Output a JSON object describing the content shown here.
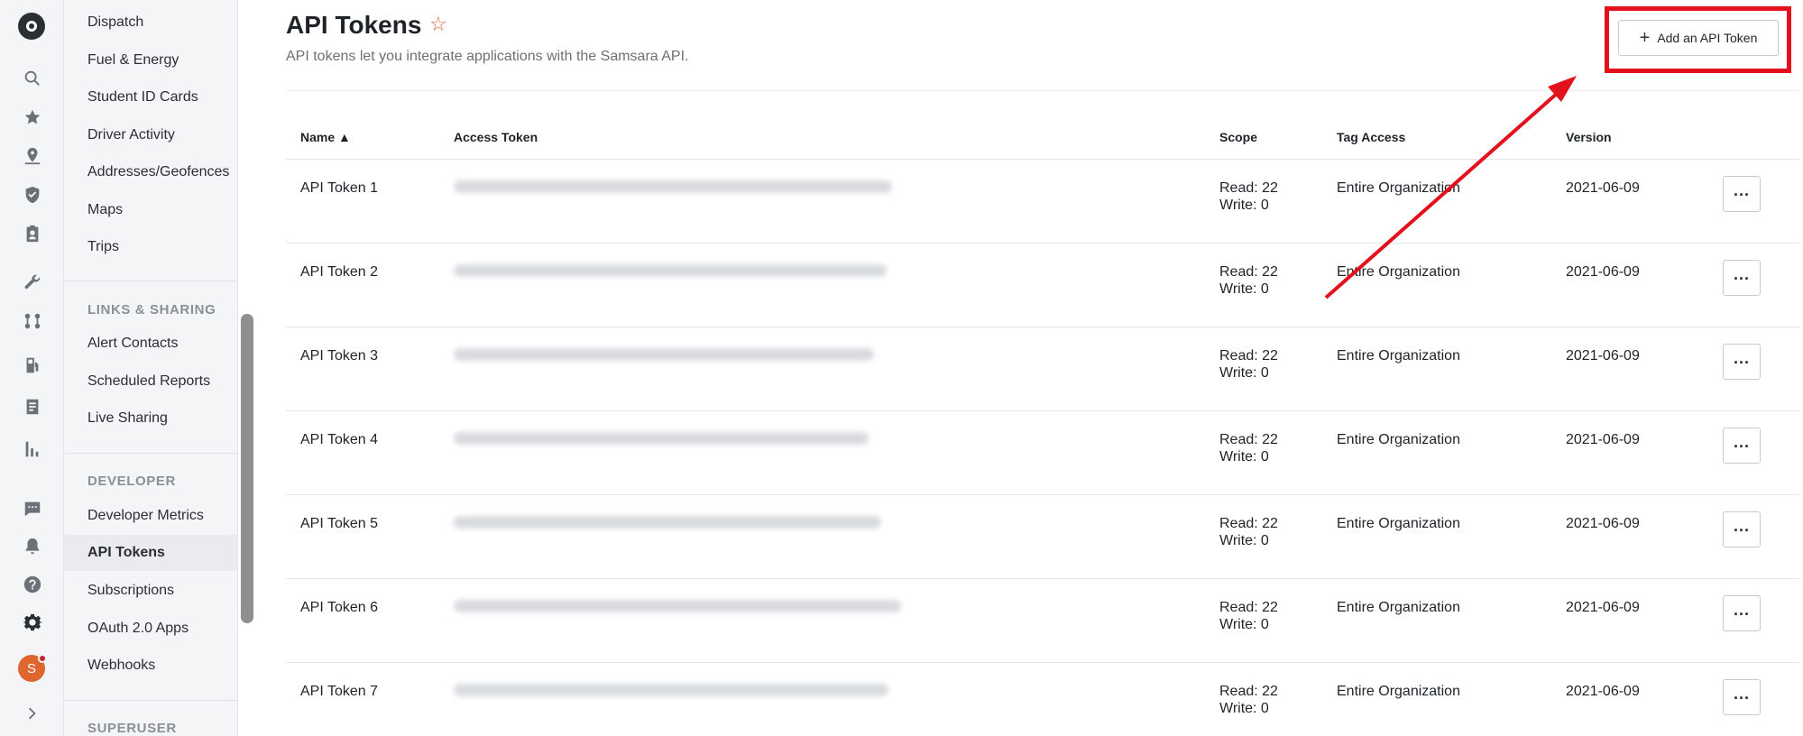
{
  "rail": {
    "icons": [
      "logo-icon",
      "search-icon",
      "star-icon",
      "map-pin-icon",
      "shield-icon",
      "clipboard-icon",
      "wrench-icon",
      "route-icon",
      "fuel-icon",
      "document-icon",
      "bar-chart-icon",
      "chat-icon",
      "bell-icon",
      "help-icon",
      "gear-icon",
      "chevron-right-icon"
    ],
    "avatar_initial": "S"
  },
  "nav": {
    "items_top": [
      "Dispatch",
      "Fuel & Energy",
      "Student ID Cards",
      "Driver Activity",
      "Addresses/Geofences",
      "Maps",
      "Trips"
    ],
    "section_links": "LINKS & SHARING",
    "items_links": [
      "Alert Contacts",
      "Scheduled Reports",
      "Live Sharing"
    ],
    "section_developer": "DEVELOPER",
    "items_developer": [
      "Developer Metrics",
      "API Tokens",
      "Subscriptions",
      "OAuth 2.0 Apps",
      "Webhooks"
    ],
    "section_superuser": "SUPERUSER",
    "active": "API Tokens"
  },
  "header": {
    "title": "API Tokens",
    "subtitle": "API tokens let you integrate applications with the Samsara API.",
    "add_button_label": "Add an API Token"
  },
  "table": {
    "columns": [
      "Name ▲",
      "Access Token",
      "Scope",
      "Tag Access",
      "Version"
    ],
    "rows": [
      {
        "name": "API Token 1",
        "scope_read": "Read: 22",
        "scope_write": "Write: 0",
        "tag_access": "Entire Organization",
        "version": "2021-06-09"
      },
      {
        "name": "API Token 2",
        "scope_read": "Read: 22",
        "scope_write": "Write: 0",
        "tag_access": "Entire Organization",
        "version": "2021-06-09"
      },
      {
        "name": "API Token 3",
        "scope_read": "Read: 22",
        "scope_write": "Write: 0",
        "tag_access": "Entire Organization",
        "version": "2021-06-09"
      },
      {
        "name": "API Token 4",
        "scope_read": "Read: 22",
        "scope_write": "Write: 0",
        "tag_access": "Entire Organization",
        "version": "2021-06-09"
      },
      {
        "name": "API Token 5",
        "scope_read": "Read: 22",
        "scope_write": "Write: 0",
        "tag_access": "Entire Organization",
        "version": "2021-06-09"
      },
      {
        "name": "API Token 6",
        "scope_read": "Read: 22",
        "scope_write": "Write: 0",
        "tag_access": "Entire Organization",
        "version": "2021-06-09"
      },
      {
        "name": "API Token 7",
        "scope_read": "Read: 22",
        "scope_write": "Write: 0",
        "tag_access": "Entire Organization",
        "version": "2021-06-09"
      }
    ],
    "more_label": "..."
  },
  "colors": {
    "accent": "#e0662f",
    "annotation": "#e3111b"
  }
}
